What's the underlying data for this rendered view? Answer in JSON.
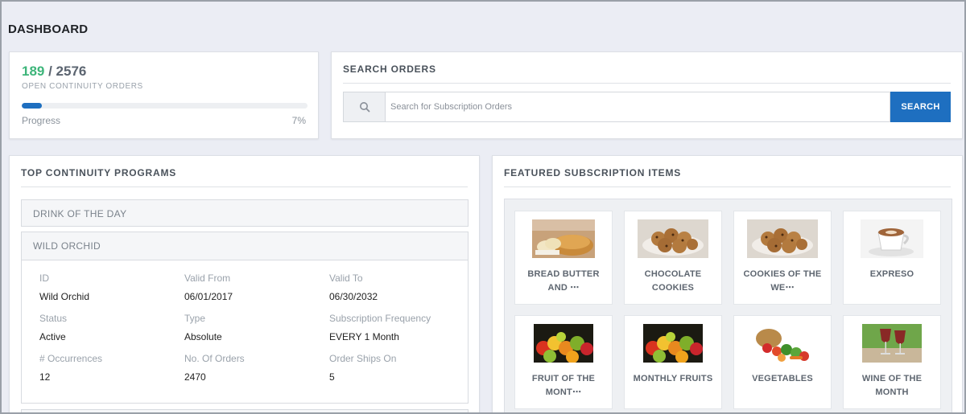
{
  "page": {
    "title": "DASHBOARD"
  },
  "stats": {
    "open_count": "189",
    "separator": " / ",
    "total_count": "2576",
    "subtitle": "OPEN CONTINUITY ORDERS",
    "progress_label": "Progress",
    "progress_value": "7%",
    "progress_fraction": 0.07,
    "accent_color": "#3db57a",
    "bar_color": "#1e6fc0"
  },
  "search": {
    "title": "SEARCH ORDERS",
    "placeholder": "Search for Subscription Orders",
    "button_label": "SEARCH",
    "icon": "search-icon",
    "button_color": "#1e6fc0"
  },
  "programs": {
    "title": "TOP CONTINUITY PROGRAMS",
    "items": [
      {
        "label": "DRINK OF THE DAY"
      },
      {
        "label": "WILD ORCHID",
        "fields": [
          {
            "label": "ID",
            "value": "Wild Orchid"
          },
          {
            "label": "Valid From",
            "value": "06/01/2017"
          },
          {
            "label": "Valid To",
            "value": "06/30/2032"
          },
          {
            "label": "Status",
            "value": "Active"
          },
          {
            "label": "Type",
            "value": "Absolute"
          },
          {
            "label": "Subscription Frequency",
            "value": "EVERY 1 Month"
          },
          {
            "label": "# Occurrences",
            "value": "12"
          },
          {
            "label": "No. Of Orders",
            "value": "2470"
          },
          {
            "label": "Order Ships On",
            "value": "5"
          }
        ]
      }
    ]
  },
  "featured": {
    "title": "FEATURED SUBSCRIPTION ITEMS",
    "items": [
      {
        "name": "BREAD BUTTER AND ⋯",
        "image": "bread-image"
      },
      {
        "name": "CHOCOLATE COOKIES",
        "image": "cookies-image"
      },
      {
        "name": "COOKIES OF THE WE⋯",
        "image": "cookies-image"
      },
      {
        "name": "EXPRESO",
        "image": "coffee-cup-image"
      },
      {
        "name": "FRUIT OF THE MONT⋯",
        "image": "fruit-basket-image"
      },
      {
        "name": "MONTHLY FRUITS",
        "image": "fruit-basket-image"
      },
      {
        "name": "VEGETABLES",
        "image": "vegetables-image"
      },
      {
        "name": "WINE OF THE MONTH",
        "image": "wine-glasses-image"
      }
    ]
  }
}
